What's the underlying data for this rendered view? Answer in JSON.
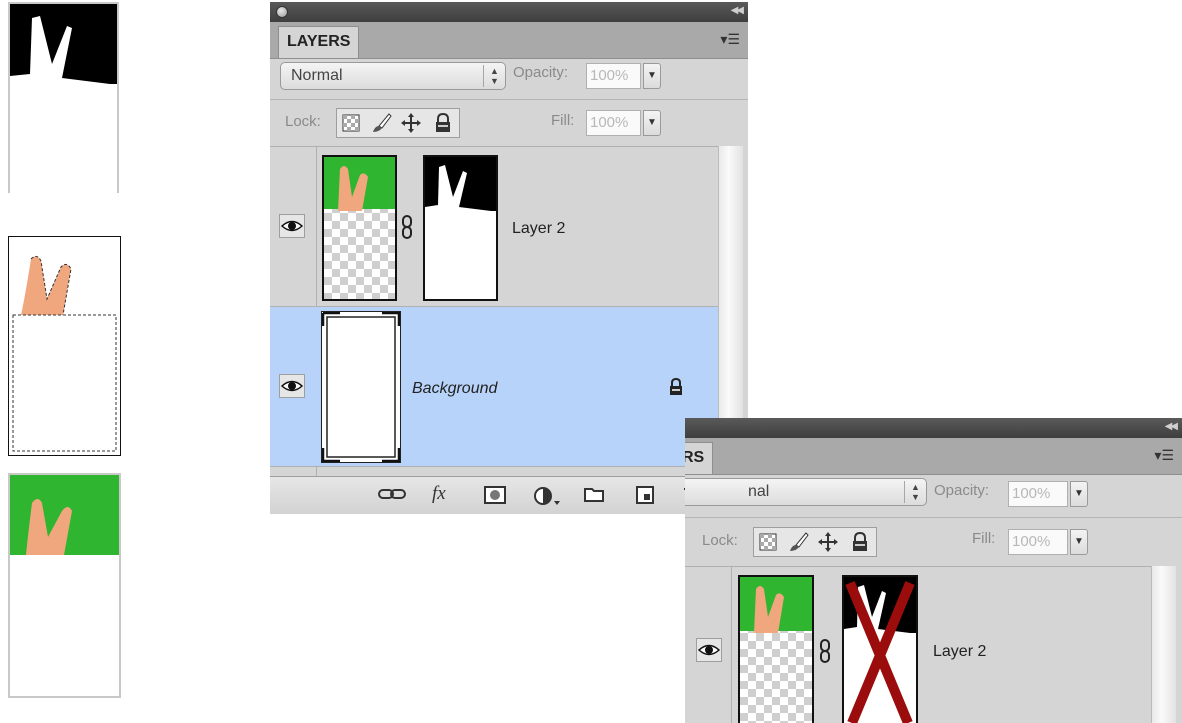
{
  "panel_main": {
    "tab_label": "LAYERS",
    "blend_mode": "Normal",
    "opacity_label": "Opacity:",
    "opacity_value": "100%",
    "lock_label": "Lock:",
    "fill_label": "Fill:",
    "fill_value": "100%",
    "layers": [
      {
        "name": "Layer 2",
        "visible": true,
        "has_mask": true,
        "selected": false
      },
      {
        "name": "Background",
        "visible": true,
        "locked": true,
        "selected": true
      }
    ],
    "bottom_icons": [
      "link-layers-icon",
      "fx-icon",
      "add-mask-icon",
      "adjustment-icon",
      "new-group-icon",
      "new-layer-icon",
      "trash-icon"
    ],
    "fx_label": "fx"
  },
  "panel_second": {
    "tab_label_partial": "RS",
    "blend_mode_partial": "nal",
    "opacity_label": "Opacity:",
    "opacity_value": "100%",
    "lock_label": "Lock:",
    "fill_label": "Fill:",
    "fill_value": "100%",
    "layers": [
      {
        "name": "Layer 2",
        "visible": true,
        "has_mask": true,
        "mask_crossed": true
      }
    ]
  },
  "colors": {
    "selected_row": "#b7d3f9",
    "panel_bg": "#d5d5d5",
    "green": "#2fb52f",
    "cross_red": "#9b0c0c"
  }
}
